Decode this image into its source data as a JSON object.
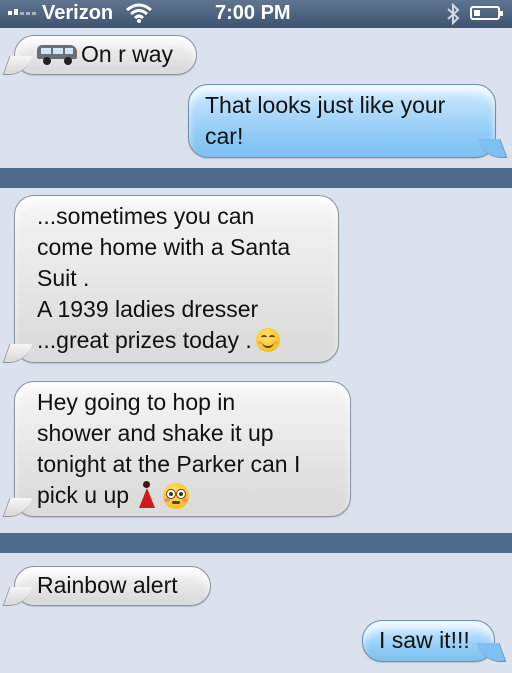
{
  "status_bar": {
    "carrier": "Verizon",
    "time": "7:00 PM",
    "bluetooth_icon": "bluetooth-icon",
    "wifi_icon": "wifi-icon",
    "battery_level": 0.25
  },
  "messages": [
    {
      "direction": "incoming",
      "icon": "van-icon",
      "lines": [
        "On r way"
      ]
    },
    {
      "direction": "outgoing",
      "lines": [
        "That looks just like your",
        "car!"
      ]
    },
    {
      "direction": "incoming",
      "lines": [
        "...sometimes you can",
        "come home with a Santa",
        "Suit .",
        "A 1939 ladies dresser",
        "...great prizes today ."
      ],
      "trailing_icon": "smiling-face-icon"
    },
    {
      "direction": "incoming",
      "lines": [
        "Hey going to hop in",
        "shower and shake it up",
        "tonight at the Parker can I",
        "pick u up"
      ],
      "trailing_icons": [
        "dancer-icon",
        "flushed-face-icon"
      ]
    },
    {
      "direction": "incoming",
      "lines": [
        "Rainbow alert"
      ]
    },
    {
      "direction": "outgoing",
      "lines": [
        "I saw it!!!"
      ]
    }
  ],
  "colors": {
    "background": "#dbe2ed",
    "divider": "#4f6b8c",
    "outgoing_bubble": "#8fcaf5",
    "incoming_bubble": "#e6e6e6"
  }
}
